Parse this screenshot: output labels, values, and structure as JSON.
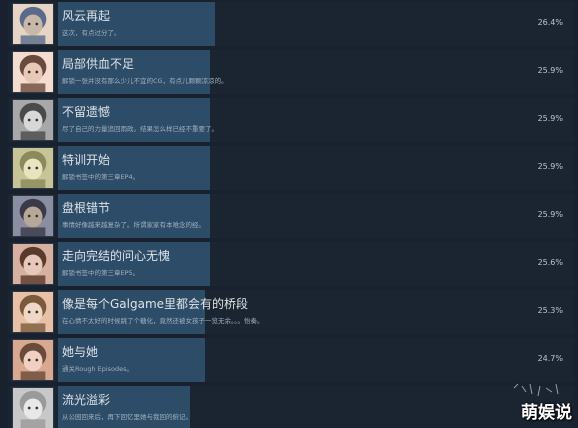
{
  "achievements": [
    {
      "title": "风云再起",
      "desc": "这次，有点过分了。",
      "percent": "26.4%",
      "bar_fraction": 0.32,
      "icon": "two-boys-icon",
      "colors": [
        "#5a6a8a",
        "#c8b8a8",
        "#e6d4c4"
      ]
    },
    {
      "title": "局部供血不足",
      "desc": "解锁一张并没有那么少儿不宜的CG，有点儿颗颗凉凉的。",
      "percent": "25.9%",
      "bar_fraction": 0.31,
      "icon": "blushing-girl-icon",
      "colors": [
        "#6a4a3a",
        "#e8c8b8",
        "#f4dcd0"
      ]
    },
    {
      "title": "不留遗憾",
      "desc": "尽了自己的力量追回雨政。结果怎么样已经不重要了。",
      "percent": "25.9%",
      "bar_fraction": 0.31,
      "icon": "room-icon",
      "colors": [
        "#4a4a4a",
        "#d8d8d8",
        "#a8a8a8"
      ]
    },
    {
      "title": "特训开始",
      "desc": "解锁书签中的第三章EP4。",
      "percent": "25.9%",
      "bar_fraction": 0.31,
      "icon": "sketch-icon",
      "colors": [
        "#8a8a5a",
        "#e8e4c0",
        "#c8c498"
      ]
    },
    {
      "title": "盘根错节",
      "desc": "事情好像越来越复杂了。所谓家家有本难念的经。",
      "percent": "25.9%",
      "bar_fraction": 0.31,
      "icon": "man-face-icon",
      "colors": [
        "#3a3a4a",
        "#b8a898",
        "#8a8ea0"
      ]
    },
    {
      "title": "走向完结的问心无愧",
      "desc": "解锁书签中的第三章EP5。",
      "percent": "25.6%",
      "bar_fraction": 0.31,
      "icon": "brown-hair-girl-icon",
      "colors": [
        "#5a3a2a",
        "#e8c8b8",
        "#d8b0a0"
      ]
    },
    {
      "title": "像是每个Galgame里都会有的桥段",
      "desc": "在心情不太好的时候跳了个糖化，竟然还被女孩子一览无余。。。怡奏。",
      "percent": "25.3%",
      "bar_fraction": 0.3,
      "icon": "girl-with-bow-icon",
      "colors": [
        "#7a5a3a",
        "#f0d8c8",
        "#e8c0a8"
      ]
    },
    {
      "title": "她与她",
      "desc": "通关Rough Episodes。",
      "percent": "24.7%",
      "bar_fraction": 0.3,
      "icon": "smiling-girl-icon",
      "colors": [
        "#6a4a3a",
        "#f0d0c0",
        "#d8a890"
      ]
    },
    {
      "title": "流光溢彩",
      "desc": "从公园回来后，再下回忆里她与我回的俯记。",
      "percent": "",
      "bar_fraction": 0.27,
      "icon": "line-sketch-icon",
      "colors": [
        "#9a9a9a",
        "#e8e8e8",
        "#c8c8c8"
      ]
    }
  ],
  "watermark": {
    "text": "萌娱说"
  }
}
